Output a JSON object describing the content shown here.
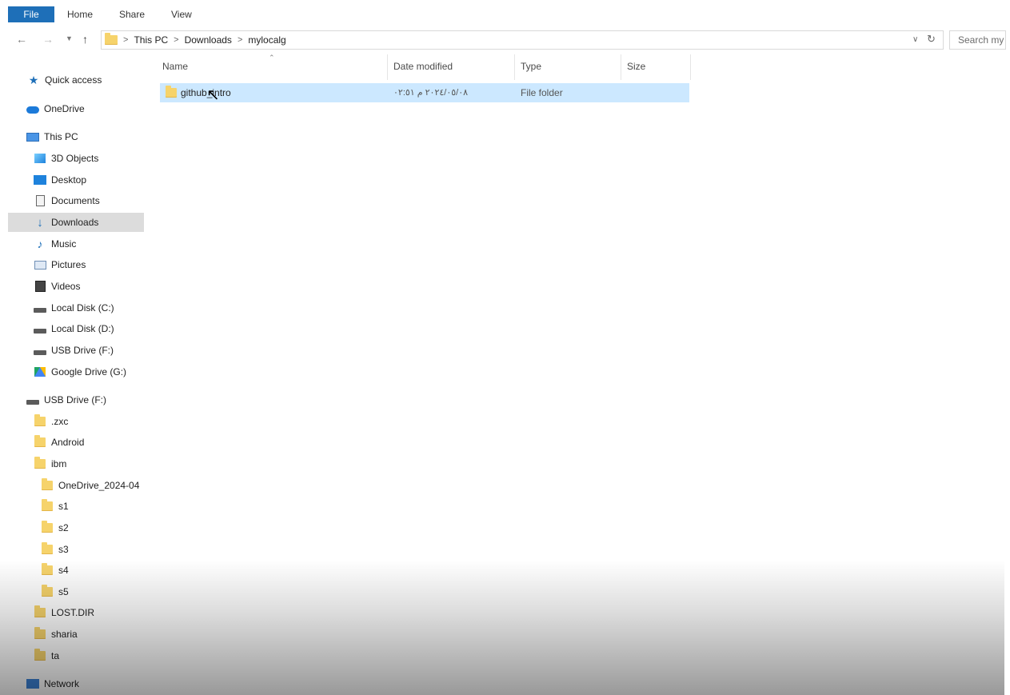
{
  "ribbon": {
    "tabs": [
      "File",
      "Home",
      "Share",
      "View"
    ]
  },
  "address": {
    "crumbs": [
      "This PC",
      "Downloads",
      "mylocalg"
    ],
    "search_placeholder": "Search my"
  },
  "nav": {
    "quick_access": "Quick access",
    "onedrive": "OneDrive",
    "this_pc": "This PC",
    "pc_items": [
      "3D Objects",
      "Desktop",
      "Documents",
      "Downloads",
      "Music",
      "Pictures",
      "Videos",
      "Local Disk (C:)",
      "Local Disk (D:)",
      "USB Drive (F:)",
      "Google Drive (G:)"
    ],
    "usb_drive": "USB Drive (F:)",
    "usb_folders": [
      ".zxc",
      "Android",
      "ibm"
    ],
    "ibm_folders": [
      "OneDrive_2024-04",
      "s1",
      "s2",
      "s3",
      "s4",
      "s5"
    ],
    "usb_folders_2": [
      "LOST.DIR",
      "sharia",
      "ta"
    ],
    "network": "Network"
  },
  "columns": {
    "name": "Name",
    "date": "Date modified",
    "type": "Type",
    "size": "Size"
  },
  "files": [
    {
      "name": "github_intro",
      "date": "٢٠٢٤/٠٥/٠٨ م ٠٢:٥١",
      "type": "File folder",
      "size": ""
    }
  ],
  "colors": {
    "selection": "#cce8ff",
    "file_tab": "#1e6fb8",
    "folder": "#f6d36b"
  }
}
